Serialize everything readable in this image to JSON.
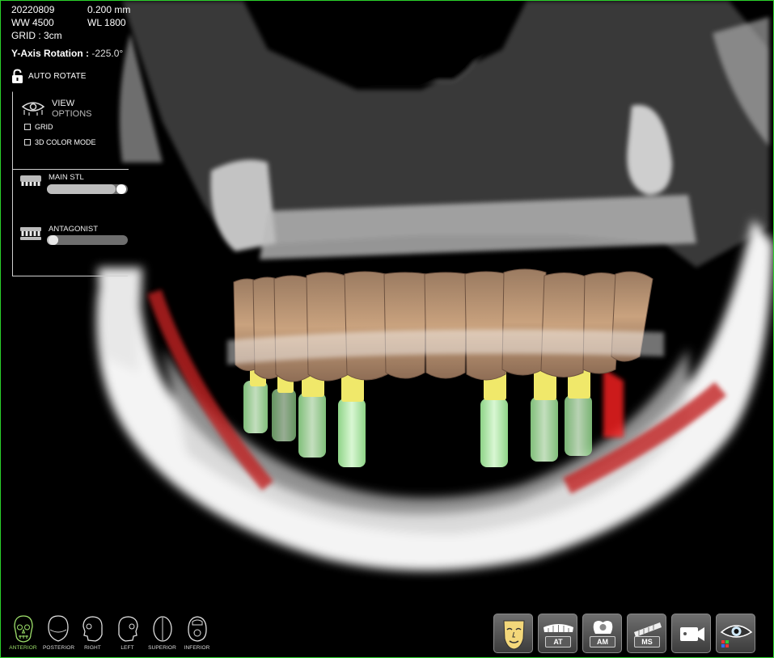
{
  "scan_info": {
    "date": "20220809",
    "slice": "0.200 mm",
    "ww": "WW 4500",
    "wl": "WL 1800",
    "grid": "GRID : 3cm",
    "rotation_label": "Y-Axis Rotation :",
    "rotation_value": "-225.0°"
  },
  "auto_rotate": {
    "label": "AUTO ROTATE",
    "icon": "lock-icon"
  },
  "view_options": {
    "title_line1": "VIEW",
    "title_line2": "OPTIONS",
    "grid_label": "GRID",
    "grid_checked": false,
    "color_mode_label": "3D COLOR MODE",
    "color_mode_checked": false
  },
  "meshes": [
    {
      "name": "MAIN STL",
      "opacity": 0.9,
      "icon": "upper-arch-icon"
    },
    {
      "name": "ANTAGONIST",
      "opacity": 0.2,
      "icon": "lower-arch-icon"
    }
  ],
  "orientation_views": [
    {
      "label": "ANTERIOR",
      "active": true
    },
    {
      "label": "POSTERIOR",
      "active": false
    },
    {
      "label": "RIGHT",
      "active": false
    },
    {
      "label": "LEFT",
      "active": false
    },
    {
      "label": "SUPERIOR",
      "active": false
    },
    {
      "label": "INFERIOR",
      "active": false
    }
  ],
  "tools": [
    {
      "icon": "face-mask-icon",
      "tag": ""
    },
    {
      "icon": "teeth-icon",
      "tag": "AT"
    },
    {
      "icon": "tooth-icon",
      "tag": "AM"
    },
    {
      "icon": "model-icon",
      "tag": "MS"
    },
    {
      "icon": "video-camera-icon",
      "tag": ""
    },
    {
      "icon": "eye-visibility-icon",
      "tag": ""
    }
  ],
  "colors": {
    "frame": "#2bd12b",
    "active_view": "#9ee06b",
    "crown": "#c9a27e",
    "abutment": "#f0e86a",
    "implant": "#a9e8a0",
    "nerve": "#d62b2b"
  }
}
